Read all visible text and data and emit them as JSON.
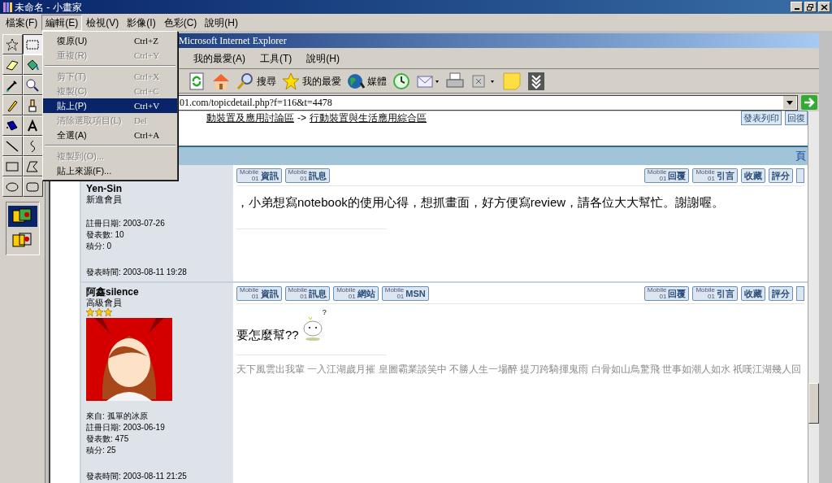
{
  "window": {
    "title": "未命名 - 小畫家"
  },
  "menu": [
    {
      "label": "檔案(F)",
      "selected": false
    },
    {
      "label": "編輯(E)",
      "selected": true
    },
    {
      "label": "檢視(V)",
      "selected": false
    },
    {
      "label": "影像(I)",
      "selected": false
    },
    {
      "label": "色彩(C)",
      "selected": false
    },
    {
      "label": "說明(H)",
      "selected": false
    }
  ],
  "dropdown": [
    {
      "kind": "item",
      "label": "復原(U)",
      "shortcut": "Ctrl+Z",
      "disabled": false,
      "selected": false
    },
    {
      "kind": "item",
      "label": "重複(R)",
      "shortcut": "Ctrl+Y",
      "disabled": true,
      "selected": false
    },
    {
      "kind": "separator"
    },
    {
      "kind": "item",
      "label": "剪下(T)",
      "shortcut": "Ctrl+X",
      "disabled": true,
      "selected": false
    },
    {
      "kind": "item",
      "label": "複製(C)",
      "shortcut": "Ctrl+C",
      "disabled": true,
      "selected": false
    },
    {
      "kind": "item",
      "label": "貼上(P)",
      "shortcut": "Ctrl+V",
      "disabled": false,
      "selected": true
    },
    {
      "kind": "item",
      "label": "清除選取項目(L)",
      "shortcut": "Del",
      "disabled": true,
      "selected": false
    },
    {
      "kind": "item",
      "label": "全選(A)",
      "shortcut": "Ctrl+A",
      "disabled": false,
      "selected": false
    },
    {
      "kind": "separator"
    },
    {
      "kind": "item",
      "label": "複製到(O)...",
      "disabled": true,
      "selected": false
    },
    {
      "kind": "item",
      "label": "貼上來源(F)...",
      "disabled": false,
      "selected": false
    }
  ],
  "tools": [
    {
      "kind": "free-select",
      "selected": false
    },
    {
      "kind": "rect-select",
      "selected": true
    },
    {
      "kind": "eraser",
      "selected": false
    },
    {
      "kind": "fill",
      "selected": false
    },
    {
      "kind": "picker",
      "selected": false
    },
    {
      "kind": "magnifier",
      "selected": false
    },
    {
      "kind": "pencil",
      "selected": false
    },
    {
      "kind": "brush",
      "selected": false
    },
    {
      "kind": "airbrush",
      "selected": false
    },
    {
      "kind": "text",
      "selected": false
    },
    {
      "kind": "line",
      "selected": false
    },
    {
      "kind": "curve",
      "selected": false
    },
    {
      "kind": "rectangle",
      "selected": false
    },
    {
      "kind": "polygon",
      "selected": false
    },
    {
      "kind": "ellipse",
      "selected": false
    },
    {
      "kind": "rounded-rect",
      "selected": false
    }
  ],
  "tool_options": [
    {
      "selected": true
    },
    {
      "selected": false
    }
  ],
  "browser": {
    "title": "Microsoft Internet Explorer",
    "menu": [
      "我的最愛(A)",
      "工具(T)",
      "說明(H)"
    ],
    "toolbar": [
      {
        "kind": "refresh"
      },
      {
        "kind": "home"
      },
      {
        "kind": "search",
        "label": "搜尋"
      },
      {
        "kind": "favorites",
        "label": "我的最愛"
      },
      {
        "kind": "media",
        "label": "媒體"
      },
      {
        "kind": "history"
      },
      {
        "kind": "mail"
      },
      {
        "kind": "print"
      },
      {
        "kind": "edit"
      },
      {
        "kind": "note"
      },
      {
        "kind": "extra"
      }
    ],
    "address": "01.com/topicdetail.php?f=116&t=4478"
  },
  "forum": {
    "breadcrumb": [
      "動裝置及應用討論區",
      "->",
      "行動裝置與生活應用綜合區"
    ],
    "top_links": [
      "發表列印",
      "回復"
    ],
    "header_link": "頁",
    "posts": [
      {
        "author": "Yen-Sin",
        "rank": "新進會員",
        "info": [
          "註冊日期: 2003-07-26",
          "發表數: 10",
          "積分: 0"
        ],
        "time": "發表時間: 2003-08-11 19:28",
        "left_buttons": [
          {
            "brand": "Mobile",
            "sub": "01",
            "label": "資訊"
          },
          {
            "brand": "Mobile",
            "sub": "01",
            "label": "訊息"
          }
        ],
        "right_buttons": [
          {
            "brand": "Mobile",
            "sub": "01",
            "label": "回覆"
          },
          {
            "brand": "Mobile",
            "sub": "01",
            "label": "引言"
          },
          {
            "label": "收藏"
          },
          {
            "label": "評分"
          }
        ],
        "body": "，小弟想寫notebook的使用心得，想抓畫面，好方便寫review，請各位大大幫忙。謝謝喔。"
      },
      {
        "author": "阿鑫silence",
        "rank": "高級會員",
        "stars": 3,
        "info": [
          "來自: 孤單的冰原",
          "註冊日期: 2003-06-19",
          "發表數: 475",
          "積分: 25"
        ],
        "time": "發表時間: 2003-08-11 21:25",
        "left_buttons": [
          {
            "brand": "Mobile",
            "sub": "01",
            "label": "資訊"
          },
          {
            "brand": "Mobile",
            "sub": "01",
            "label": "訊息"
          },
          {
            "brand": "Mobile",
            "sub": "01",
            "label": "網站"
          },
          {
            "brand": "Mobile",
            "sub": "01",
            "label": "MSN"
          }
        ],
        "right_buttons": [
          {
            "brand": "Mobile",
            "sub": "01",
            "label": "回覆"
          },
          {
            "brand": "Mobile",
            "sub": "01",
            "label": "引言"
          },
          {
            "label": "收藏"
          },
          {
            "label": "評分"
          }
        ],
        "body": "要怎麼幫??",
        "emoticon_mark": "?",
        "signature": "天下風雲出我輩 一入江湖歲月摧 皇圖霸業談笑中 不勝人生一場醉 提刀跨騎揮鬼雨 白骨如山鳥驚飛 世事如潮人如水 祇嘆江湖幾人回"
      }
    ]
  }
}
